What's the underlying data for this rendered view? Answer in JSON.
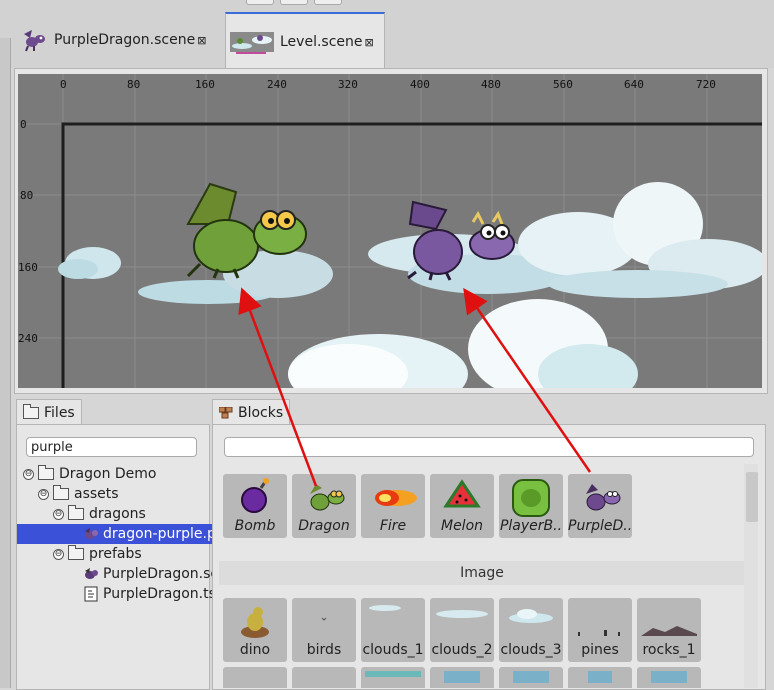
{
  "editor_tabs": [
    {
      "label": "PurpleDragon.scene",
      "close": "⊠"
    },
    {
      "label": "Level.scene",
      "close": "⊠"
    }
  ],
  "ruler": {
    "x_ticks": [
      "0",
      "80",
      "160",
      "240",
      "320",
      "400",
      "480",
      "560",
      "640",
      "720"
    ],
    "y_ticks": [
      "0",
      "80",
      "160",
      "240"
    ]
  },
  "files_panel": {
    "title": "Files",
    "search_value": "purple",
    "tree": [
      {
        "label": "Dragon Demo",
        "toggle": "⊖"
      },
      {
        "label": "assets",
        "toggle": "⊖"
      },
      {
        "label": "dragons",
        "toggle": "⊖"
      },
      {
        "label": "dragon-purple.png",
        "selected": true
      },
      {
        "label": "prefabs",
        "toggle": "⊖"
      },
      {
        "label": "PurpleDragon.scene"
      },
      {
        "label": "PurpleDragon.ts"
      }
    ]
  },
  "blocks_panel": {
    "title": "Blocks",
    "search_value": "",
    "prefab_tiles": [
      "Bomb",
      "Dragon",
      "Fire",
      "Melon",
      "PlayerB..",
      "PurpleD.."
    ],
    "section_label": "Image",
    "image_tiles": [
      "dino",
      "birds",
      "clouds_1",
      "clouds_2",
      "clouds_3",
      "pines",
      "rocks_1"
    ]
  },
  "colors": {
    "accent": "#3a6cd8",
    "selection": "#3a51d8",
    "arrow": "#e01010",
    "scene_bg": "#7a7a7a"
  }
}
